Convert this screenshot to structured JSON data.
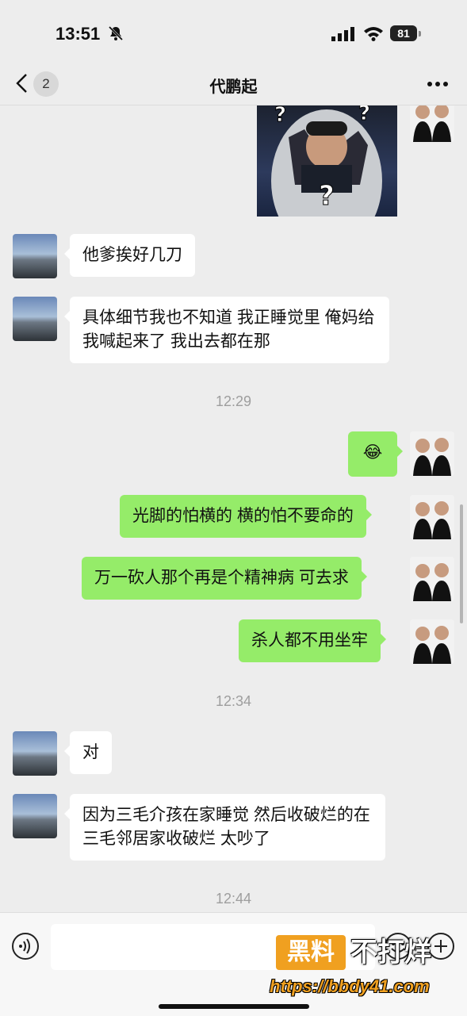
{
  "status": {
    "time": "13:51",
    "battery": "81"
  },
  "nav": {
    "back_count": "2",
    "title": "代鹏起"
  },
  "messages": [
    {
      "side": "left",
      "text": "他爹挨好几刀"
    },
    {
      "side": "left",
      "text": "具体细节我也不知道 我正睡觉里 俺妈给我喊起来了 我出去都在那"
    },
    {
      "side": "right",
      "emoji": "😂"
    },
    {
      "side": "right",
      "text": "光脚的怕横的 横的怕不要命的"
    },
    {
      "side": "right",
      "text": "万一砍人那个再是个精神病 可去求"
    },
    {
      "side": "right",
      "text": "杀人都不用坐牢"
    },
    {
      "side": "left",
      "text": "对"
    },
    {
      "side": "left",
      "text": "因为三毛介孩在家睡觉 然后收破烂的在三毛邻居家收破烂 太吵了"
    }
  ],
  "timestamps": [
    "12:29",
    "12:34",
    "12:44"
  ],
  "watermark": {
    "badge": "黑料",
    "text": "不打烊",
    "url": "https://bbdy41.com"
  },
  "icons": [
    "back-icon",
    "more-icon",
    "voice-icon",
    "emoji-icon",
    "plus-icon",
    "bell-slash-icon",
    "signal-icon",
    "wifi-icon"
  ]
}
